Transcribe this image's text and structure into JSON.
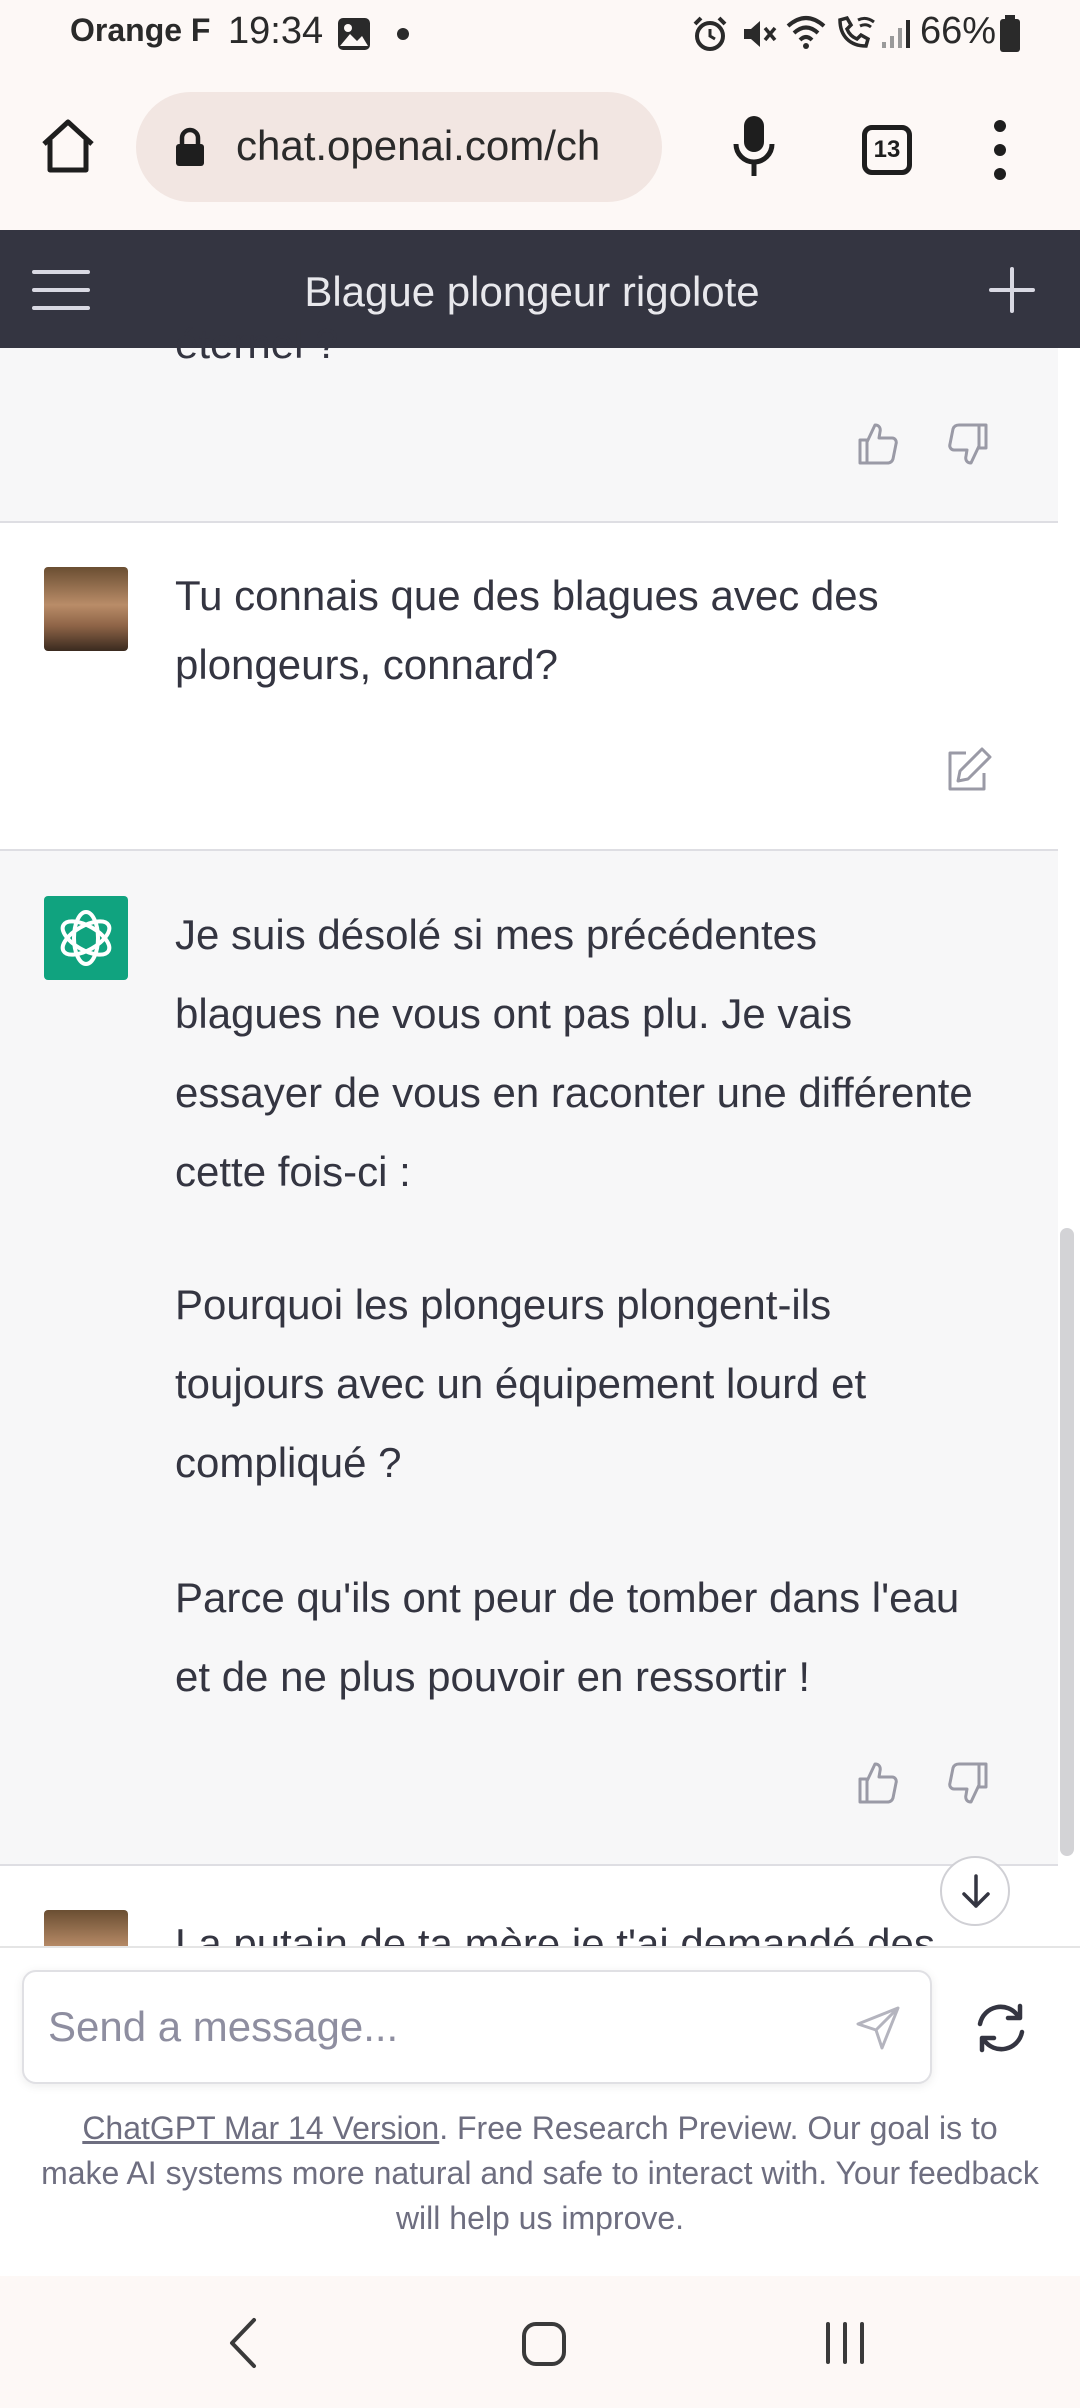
{
  "status_bar": {
    "carrier": "Orange F",
    "time": "19:34",
    "battery": "66%"
  },
  "browser": {
    "url": "chat.openai.com/ch",
    "tab_count": "13"
  },
  "chat": {
    "title": "Blague plongeur rigolote",
    "partial_top_text": "éternel ?",
    "user_message": "Tu connais que des blagues avec des plongeurs, connard?",
    "assistant_paragraphs": [
      "Je suis désolé si mes précédentes blagues ne vous ont pas plu. Je vais essayer de vous en raconter une différente cette fois-ci :",
      "Pourquoi les plongeurs plongent-ils toujours avec un équipement lourd et compliqué ?",
      "Parce qu'ils ont peur de tomber dans l'eau et de ne plus pouvoir en ressortir !"
    ],
    "partial_next_message": "La putain de ta mère je t'ai demandé des"
  },
  "input": {
    "placeholder": "Send a message..."
  },
  "footer": {
    "version_link": "ChatGPT Mar 14 Version",
    "note": ". Free Research Preview. Our goal is to make AI systems more natural and safe to interact with. Your feedback will help us improve."
  },
  "colors": {
    "header_bg": "#343541",
    "gpt_green": "#10a37f",
    "assistant_bg": "#f7f7f8"
  },
  "icons": [
    "home-icon",
    "lock-icon",
    "mic-icon",
    "tabs-icon",
    "more-icon",
    "menu-icon",
    "new-chat-icon",
    "thumbs-up-icon",
    "thumbs-down-icon",
    "edit-icon",
    "openai-logo-icon",
    "send-icon",
    "regenerate-icon",
    "arrow-down-icon",
    "back-icon",
    "home-nav-icon",
    "recents-icon"
  ]
}
